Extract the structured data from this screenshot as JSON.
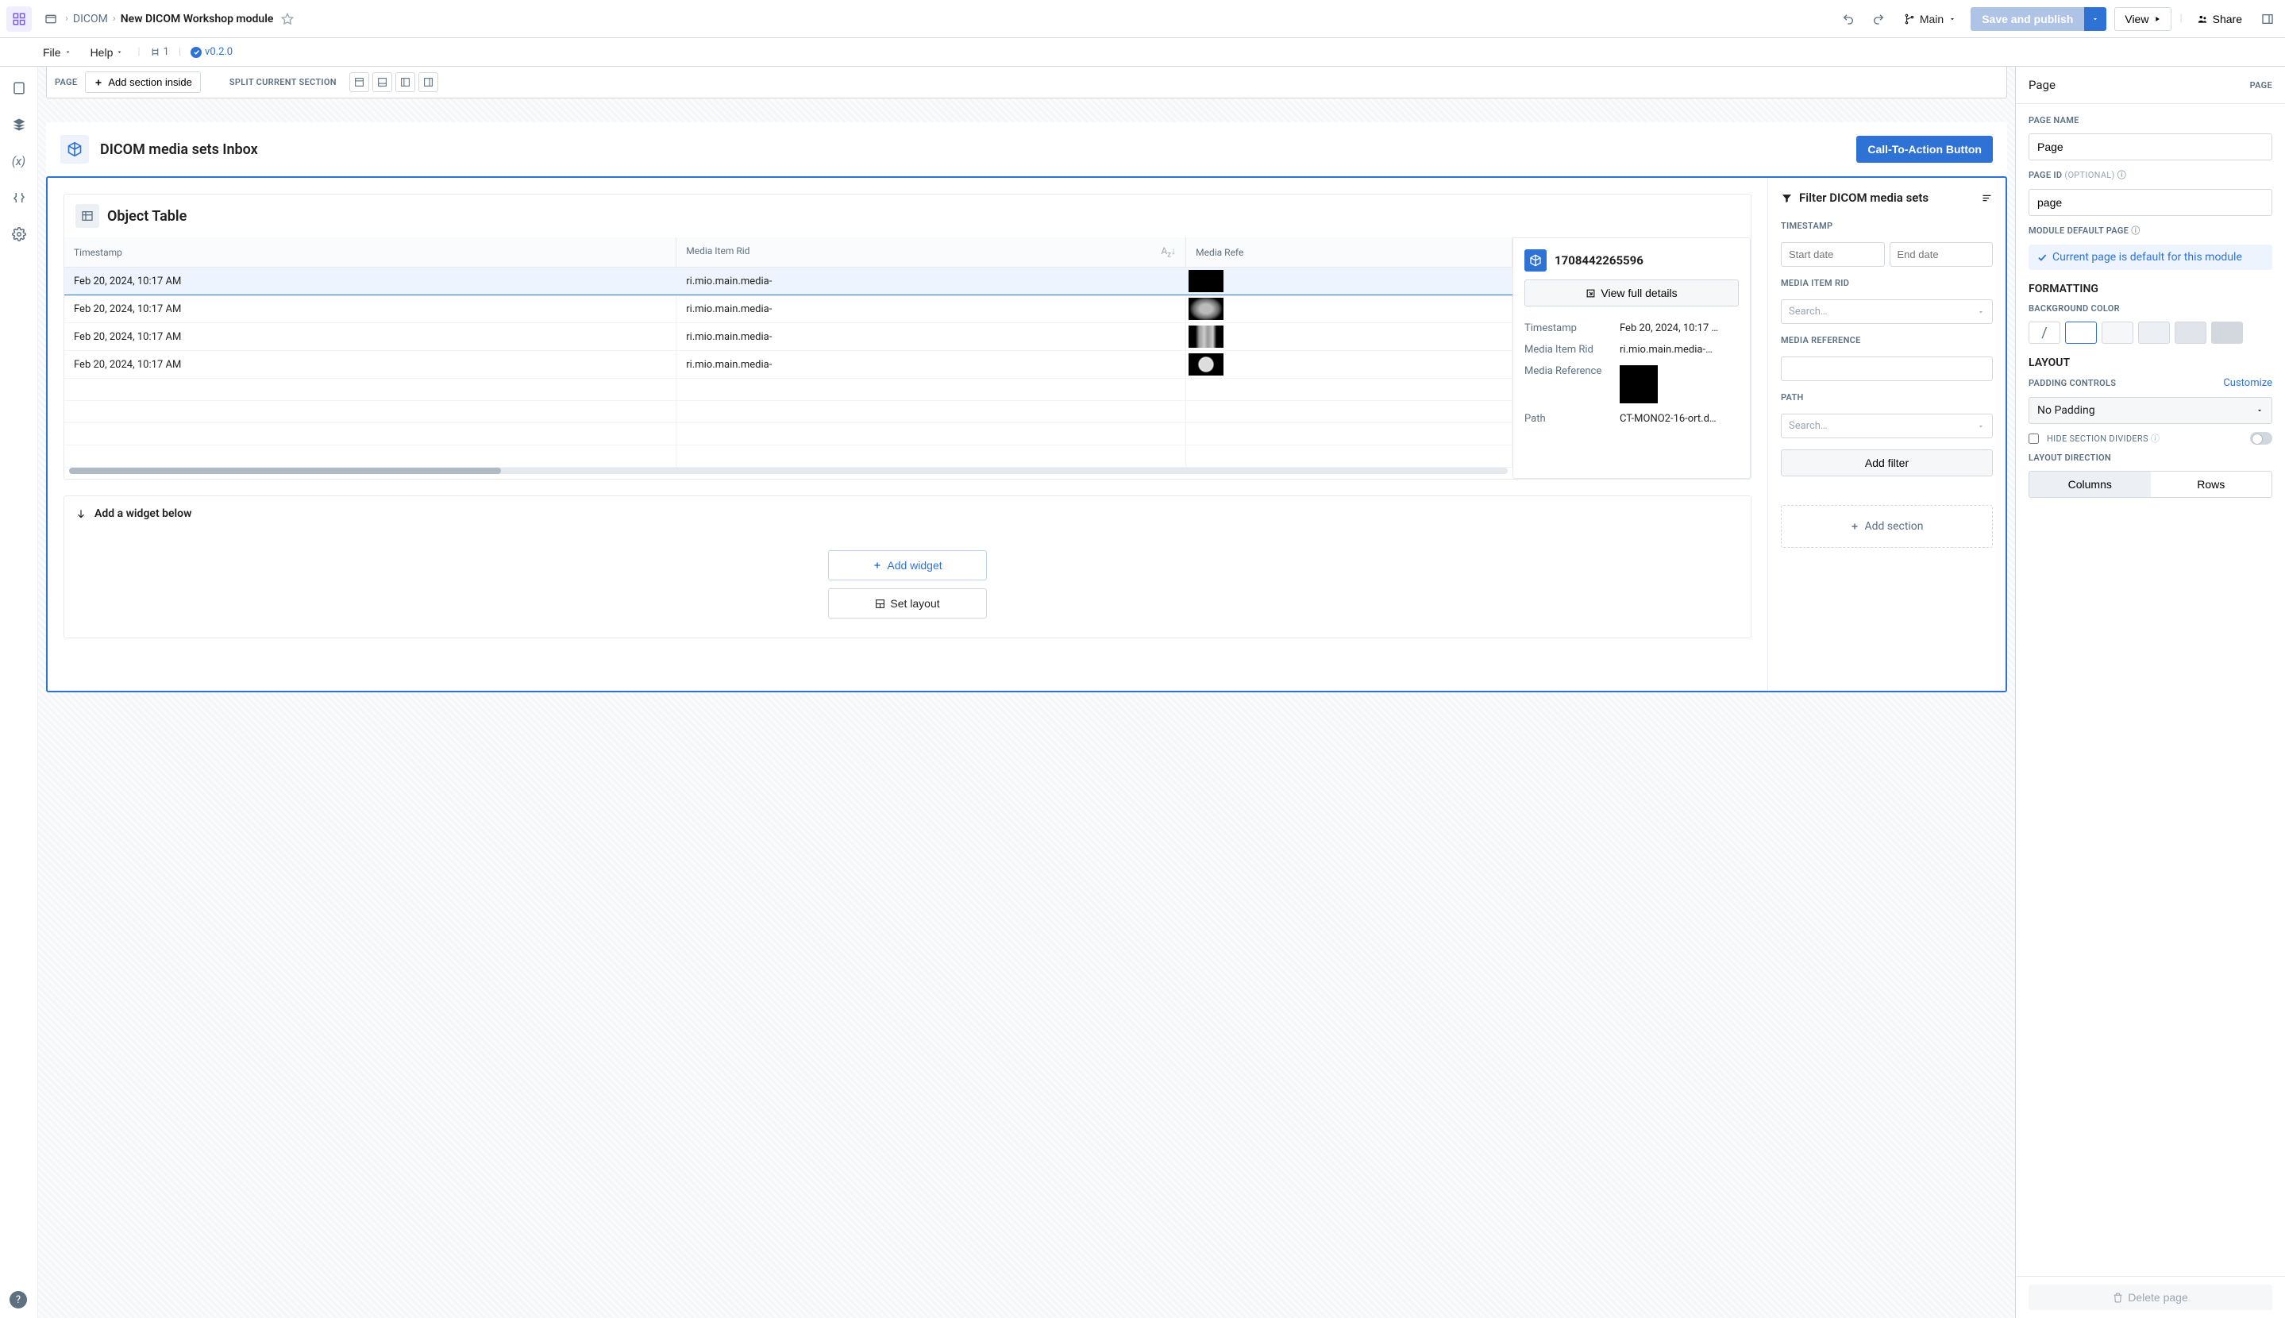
{
  "breadcrumbs": {
    "parent": "DICOM",
    "current": "New DICOM Workshop module"
  },
  "menus": {
    "file": "File",
    "help": "Help"
  },
  "user_count": "1",
  "version": "v0.2.0",
  "topbar": {
    "branch": "Main",
    "save_publish": "Save and publish",
    "view": "View",
    "share": "Share"
  },
  "canvas_bar": {
    "page_label": "PAGE",
    "add_section_inside": "Add section inside",
    "split_label": "SPLIT CURRENT SECTION"
  },
  "section_header": {
    "title": "DICOM media sets Inbox",
    "cta": "Call-To-Action Button"
  },
  "object_table": {
    "title": "Object Table",
    "columns": {
      "timestamp": "Timestamp",
      "media_item_rid": "Media Item Rid",
      "media_reference": "Media Refe"
    },
    "rows": [
      {
        "timestamp": "Feb 20, 2024, 10:17 AM",
        "rid": "ri.mio.main.media-",
        "thumb_class": ""
      },
      {
        "timestamp": "Feb 20, 2024, 10:17 AM",
        "rid": "ri.mio.main.media-",
        "thumb_class": "thumb-brain"
      },
      {
        "timestamp": "Feb 20, 2024, 10:17 AM",
        "rid": "ri.mio.main.media-",
        "thumb_class": "thumb-knee"
      },
      {
        "timestamp": "Feb 20, 2024, 10:17 AM",
        "rid": "ri.mio.main.media-",
        "thumb_class": "thumb-ct"
      }
    ]
  },
  "details": {
    "id": "1708442265596",
    "view_full": "View full details",
    "fields": {
      "timestamp_k": "Timestamp",
      "timestamp_v": "Feb 20, 2024, 10:17 …",
      "rid_k": "Media Item Rid",
      "rid_v": "ri.mio.main.media-…",
      "reference_k": "Media Reference",
      "path_k": "Path",
      "path_v": "CT-MONO2-16-ort.d…"
    }
  },
  "add_widget": {
    "title": "Add a widget below",
    "add_widget_btn": "Add widget",
    "set_layout_btn": "Set layout"
  },
  "filter": {
    "title": "Filter DICOM media sets",
    "timestamp_label": "TIMESTAMP",
    "start_date_ph": "Start date",
    "end_date_ph": "End date",
    "rid_label": "MEDIA ITEM RID",
    "reference_label": "MEDIA REFERENCE",
    "path_label": "PATH",
    "search_ph": "Search…",
    "add_filter": "Add filter",
    "add_section": "Add section"
  },
  "inspector": {
    "header": "Page",
    "header_type": "PAGE",
    "page_name_label": "PAGE NAME",
    "page_name_value": "Page",
    "page_id_label": "PAGE ID",
    "page_id_optional": "(OPTIONAL)",
    "page_id_value": "page",
    "default_page_label": "MODULE DEFAULT PAGE",
    "default_banner": "Current page is default for this module",
    "formatting": "FORMATTING",
    "bg_color": "BACKGROUND COLOR",
    "layout": "LAYOUT",
    "padding_controls": "PADDING CONTROLS",
    "customize": "Customize",
    "padding_value": "No Padding",
    "hide_dividers": "HIDE SECTION DIVIDERS",
    "layout_direction": "LAYOUT DIRECTION",
    "columns": "Columns",
    "rows": "Rows",
    "delete_page": "Delete page"
  }
}
